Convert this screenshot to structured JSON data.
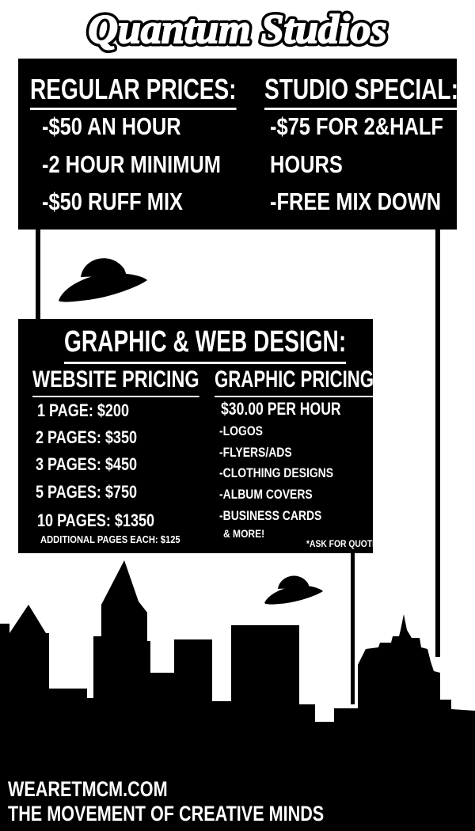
{
  "title": "Quantum Studios",
  "studio": {
    "regular": {
      "heading": "REGULAR PRICES:",
      "items": [
        "-$50 AN HOUR",
        "-2 HOUR MINIMUM",
        "-$50 RUFF MIX"
      ]
    },
    "special": {
      "heading": "STUDIO SPECIAL:",
      "items": [
        "-$75 FOR 2&HALF",
        "HOURS",
        "-FREE MIX DOWN"
      ]
    }
  },
  "design": {
    "heading": "GRAPHIC & WEB DESIGN:",
    "website": {
      "heading": "WEBSITE PRICING",
      "items": [
        "1 PAGE: $200",
        "2 PAGES: $350",
        "3 PAGES: $450",
        "5 PAGES: $750",
        "10 PAGES: $1350"
      ],
      "note": "ADDITIONAL PAGES EACH: $125"
    },
    "graphic": {
      "heading": "GRAPHIC PRICING",
      "rate": "$30.00 PER HOUR",
      "items": [
        "-LOGOS",
        "-FLYERS/ADS",
        "-CLOTHING DESIGNS",
        "-ALBUM COVERS",
        "-BUSINESS CARDS"
      ],
      "more": "& MORE!",
      "quote": "*ASK FOR QUOTE"
    }
  },
  "footer": {
    "website": "WEARETMCM.COM",
    "tagline": "THE MOVEMENT OF CREATIVE MINDS"
  },
  "colors": {
    "background": "#ffffff",
    "ink": "#000000",
    "text_on_ink": "#ffffff"
  },
  "icons": [
    "ufo-icon",
    "ufo-icon",
    "city-skyline"
  ]
}
